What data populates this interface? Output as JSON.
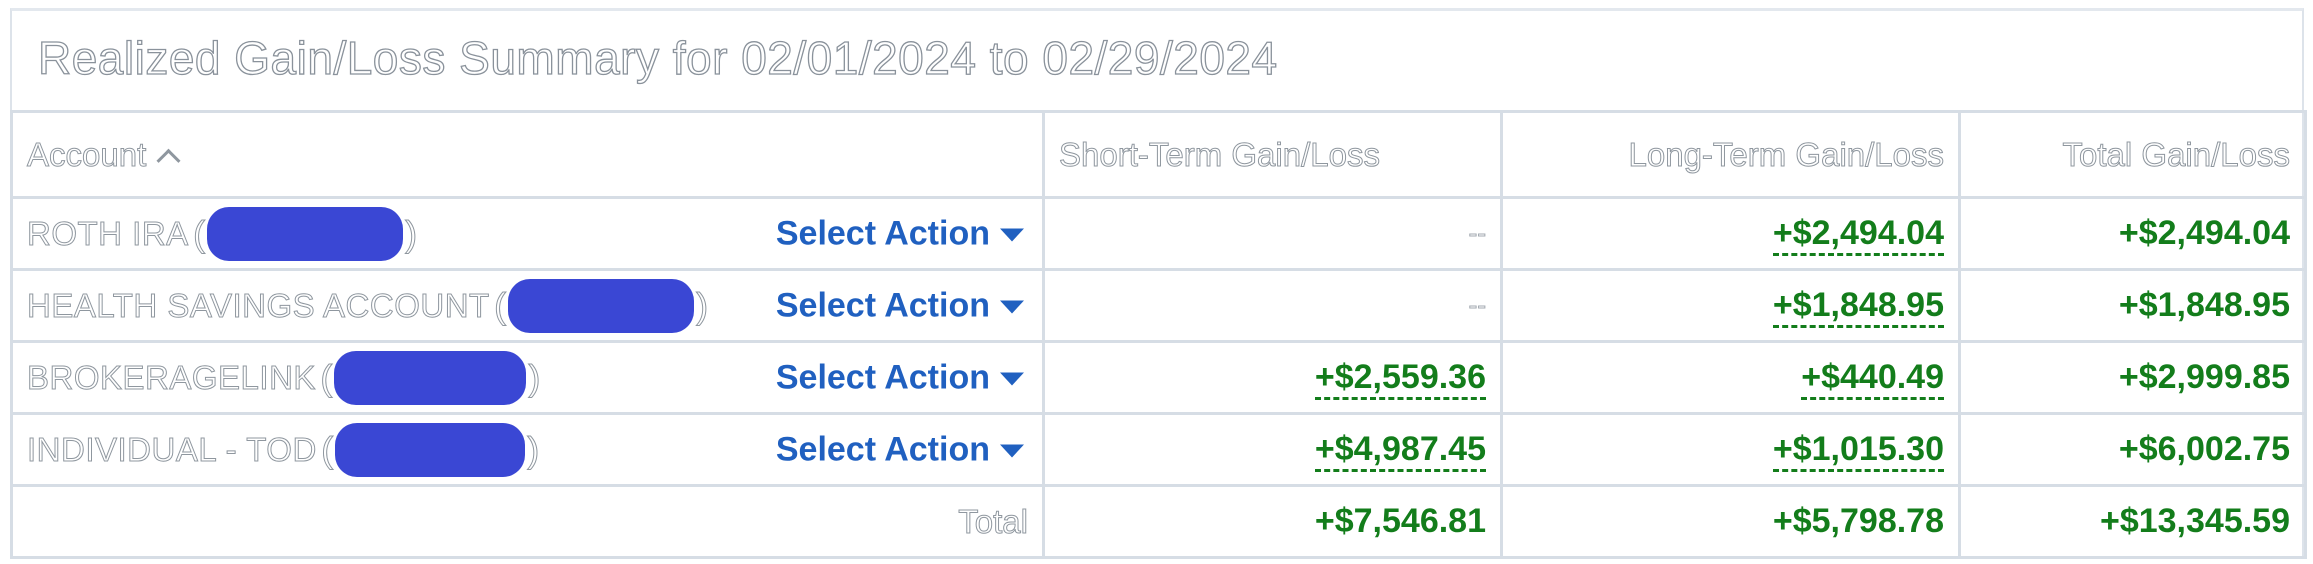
{
  "summary": {
    "title": "Realized Gain/Loss Summary for 02/01/2024 to 02/29/2024",
    "columns": {
      "account": "Account",
      "short_term": "Short-Term Gain/Loss",
      "long_term": "Long-Term Gain/Loss",
      "total": "Total Gain/Loss"
    },
    "sort_icon": "chevron-up-icon",
    "select_action_label": "Select Action",
    "rows": [
      {
        "account": "ROTH IRA",
        "short_term": "--",
        "long_term": "+$2,494.04",
        "total": "+$2,494.04"
      },
      {
        "account": "HEALTH SAVINGS ACCOUNT",
        "short_term": "--",
        "long_term": "+$1,848.95",
        "total": "+$1,848.95"
      },
      {
        "account": "BROKERAGELINK",
        "short_term": "+$2,559.36",
        "long_term": "+$440.49",
        "total": "+$2,999.85"
      },
      {
        "account": "INDIVIDUAL - TOD",
        "short_term": "+$4,987.45",
        "long_term": "+$1,015.30",
        "total": "+$6,002.75"
      }
    ],
    "totals": {
      "label": "Total",
      "short_term": "+$7,546.81",
      "long_term": "+$5,798.78",
      "total": "+$13,345.59"
    },
    "colors": {
      "gain": "#137d1b",
      "link": "#2060c0",
      "redaction": "#3a47d4",
      "border": "#d6dde5"
    }
  }
}
